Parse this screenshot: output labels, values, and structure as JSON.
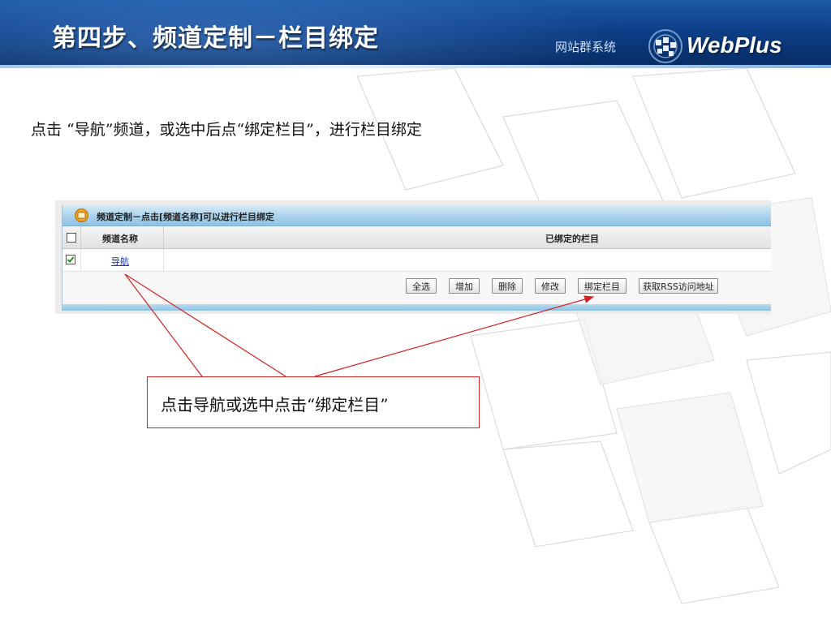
{
  "slide": {
    "title": "第四步、频道定制－栏目绑定",
    "system_label": "网站群系统",
    "logo_text": "WebPlus",
    "instruction": "点击 “导航”频道，或选中后点“绑定栏目”，进行栏目绑定"
  },
  "panel": {
    "title": "频道定制－点击[频道名称]可以进行栏目绑定",
    "icon": "folder-icon",
    "columns": {
      "name": "频道名称",
      "bound": "已绑定的栏目"
    },
    "rows": [
      {
        "checked": true,
        "name": "导航",
        "bound": ""
      }
    ],
    "buttons": {
      "select_all": "全选",
      "add": "增加",
      "delete": "删除",
      "edit": "修改",
      "bind": "绑定栏目",
      "rss": "获取RSS访问地址"
    }
  },
  "callout": {
    "text": "点击导航或选中点击“绑定栏目”",
    "color": "#d52222"
  },
  "colors": {
    "banner": "#0d3f88",
    "link": "#1a32c8",
    "panel_header": "#a9d2ec"
  }
}
